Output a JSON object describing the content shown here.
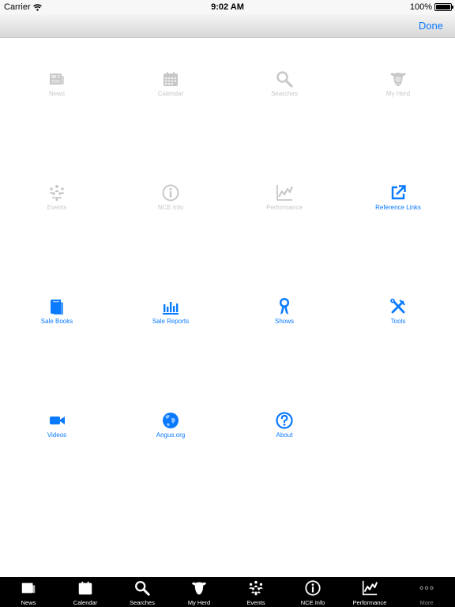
{
  "status_bar": {
    "carrier": "Carrier",
    "time": "9:02 AM",
    "battery": "100%",
    "battery_level": 1.0
  },
  "nav_bar": {
    "done_label": "Done"
  },
  "colors": {
    "accent": "#0a7aff",
    "disabled": "#c8c8c8",
    "tab_bar_bg": "#000000"
  },
  "grid": {
    "items": [
      {
        "label": "News",
        "icon": "newspaper-icon",
        "enabled": false
      },
      {
        "label": "Calendar",
        "icon": "calendar-icon",
        "enabled": false
      },
      {
        "label": "Searches",
        "icon": "magnifier-icon",
        "enabled": false
      },
      {
        "label": "My Herd",
        "icon": "cow-head-icon",
        "enabled": false
      },
      {
        "label": "Events",
        "icon": "people-group-icon",
        "enabled": false
      },
      {
        "label": "NCE Info",
        "icon": "info-circle-icon",
        "enabled": false
      },
      {
        "label": "Performance",
        "icon": "line-chart-icon",
        "enabled": false
      },
      {
        "label": "Reference Links",
        "icon": "external-link-icon",
        "enabled": true
      },
      {
        "label": "Sale Books",
        "icon": "book-icon",
        "enabled": true
      },
      {
        "label": "Sale Reports",
        "icon": "bar-chart-icon",
        "enabled": true
      },
      {
        "label": "Shows",
        "icon": "ribbon-icon",
        "enabled": true
      },
      {
        "label": "Tools",
        "icon": "tools-icon",
        "enabled": true
      },
      {
        "label": "Videos",
        "icon": "video-camera-icon",
        "enabled": true
      },
      {
        "label": "Angus.org",
        "icon": "globe-icon",
        "enabled": true
      },
      {
        "label": "About",
        "icon": "question-circle-icon",
        "enabled": true
      }
    ]
  },
  "tab_bar": {
    "tabs": [
      {
        "label": "News",
        "icon": "newspaper-icon"
      },
      {
        "label": "Calendar",
        "icon": "calendar-icon"
      },
      {
        "label": "Searches",
        "icon": "magnifier-icon"
      },
      {
        "label": "My Herd",
        "icon": "cow-head-icon"
      },
      {
        "label": "Events",
        "icon": "people-group-icon"
      },
      {
        "label": "NCE Info",
        "icon": "info-circle-icon"
      },
      {
        "label": "Performance",
        "icon": "line-chart-icon"
      },
      {
        "label": "More",
        "icon": "more-dots-icon"
      }
    ]
  }
}
